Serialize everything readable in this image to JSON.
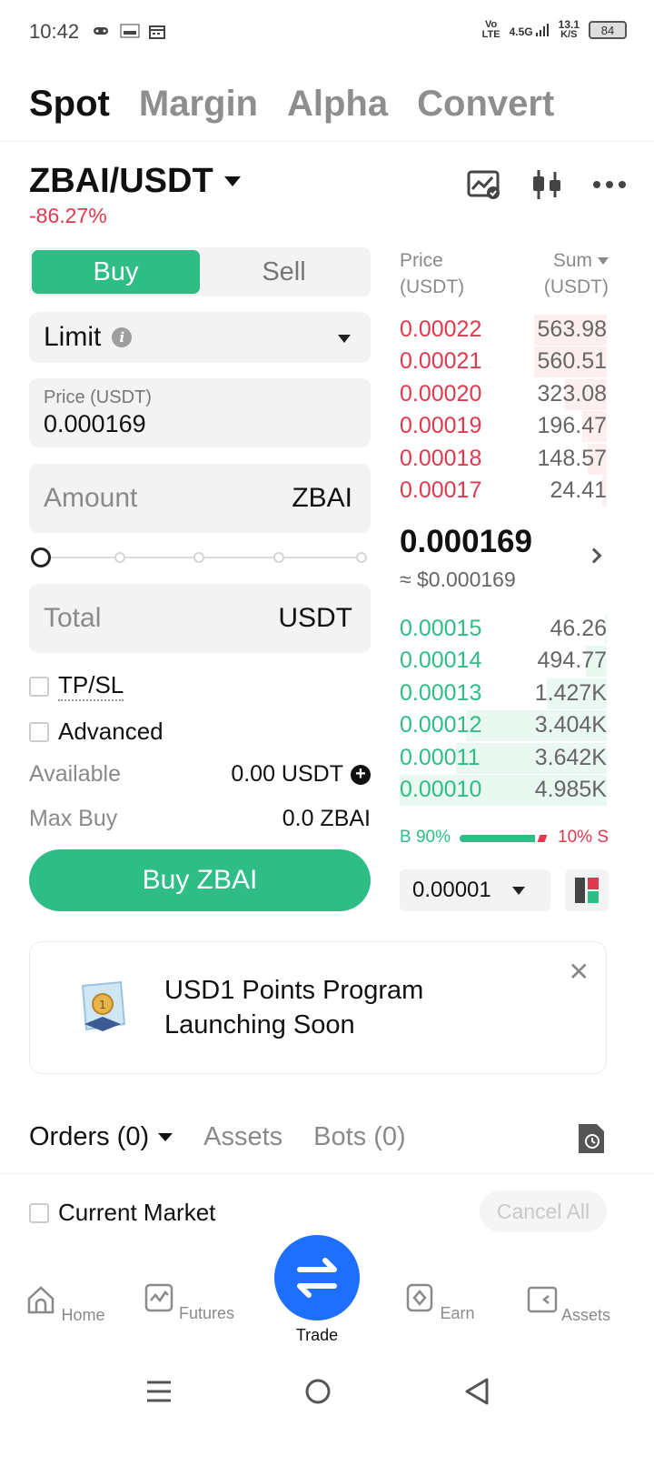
{
  "status_bar": {
    "time": "10:42",
    "net_type_top": "Vo",
    "net_type_bottom": "LTE",
    "signal": "4.5G",
    "speed_value": "13.1",
    "speed_unit": "K/S",
    "battery": "84"
  },
  "top_tabs": [
    "Spot",
    "Margin",
    "Alpha",
    "Convert"
  ],
  "pair": {
    "symbol": "ZBAI/USDT",
    "change": "-86.27%"
  },
  "order_form": {
    "buy_label": "Buy",
    "sell_label": "Sell",
    "order_type": "Limit",
    "price_label": "Price (USDT)",
    "price_value": "0.000169",
    "amount_placeholder": "Amount",
    "amount_unit": "ZBAI",
    "total_placeholder": "Total",
    "total_unit": "USDT",
    "slider_percent": 0,
    "tpsl_label": "TP/SL",
    "advanced_label": "Advanced",
    "available_label": "Available",
    "available_value": "0.00 USDT",
    "max_buy_label": "Max Buy",
    "max_buy_value": "0.0 ZBAI",
    "submit_label": "Buy ZBAI"
  },
  "order_book": {
    "price_header_1": "Price",
    "price_header_2": "(USDT)",
    "sum_header_1": "Sum",
    "sum_header_2": "(USDT)",
    "asks": [
      {
        "price": "0.00022",
        "sum": "563.98",
        "depth": 0.35
      },
      {
        "price": "0.00021",
        "sum": "560.51",
        "depth": 0.35
      },
      {
        "price": "0.00020",
        "sum": "323.08",
        "depth": 0.2
      },
      {
        "price": "0.00019",
        "sum": "196.47",
        "depth": 0.12
      },
      {
        "price": "0.00018",
        "sum": "148.57",
        "depth": 0.09
      },
      {
        "price": "0.00017",
        "sum": "24.41",
        "depth": 0.02
      }
    ],
    "last_price": "0.000169",
    "last_price_usd": "≈ $0.000169",
    "bids": [
      {
        "price": "0.00015",
        "sum": "46.26",
        "depth": 0.01
      },
      {
        "price": "0.00014",
        "sum": "494.77",
        "depth": 0.1
      },
      {
        "price": "0.00013",
        "sum": "1.427K",
        "depth": 0.29
      },
      {
        "price": "0.00012",
        "sum": "3.404K",
        "depth": 0.68
      },
      {
        "price": "0.00011",
        "sum": "3.642K",
        "depth": 0.73
      },
      {
        "price": "0.00010",
        "sum": "4.985K",
        "depth": 1.0
      }
    ],
    "buy_ratio_label": "B 90%",
    "sell_ratio_label": "10% S",
    "buy_ratio": 0.9,
    "tick_size": "0.00001"
  },
  "promo": {
    "line1": "USD1 Points Program",
    "line2": "Launching Soon"
  },
  "orders": {
    "tab_orders": "Orders (0)",
    "tab_assets": "Assets",
    "tab_bots": "Bots (0)",
    "current_market_label": "Current Market",
    "cancel_all_label": "Cancel All"
  },
  "bottom_nav": {
    "home": "Home",
    "futures": "Futures",
    "trade": "Trade",
    "earn": "Earn",
    "assets": "Assets"
  },
  "colors": {
    "buy_green": "#2ebd85",
    "sell_red": "#e0394d",
    "trade_blue": "#1f6fff"
  }
}
